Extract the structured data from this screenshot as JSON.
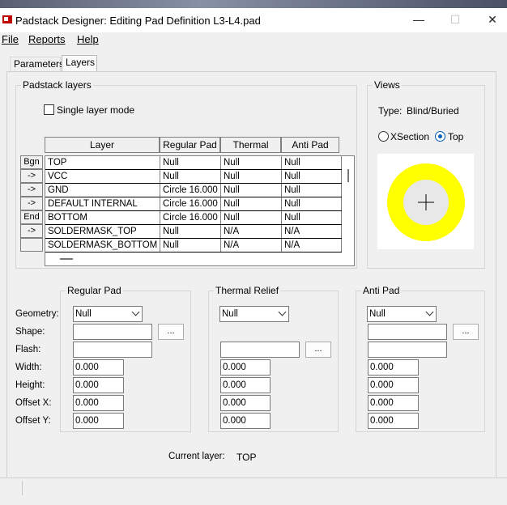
{
  "window": {
    "title": "Padstack Designer: Editing Pad Definition L3-L4.pad",
    "minimize": "—",
    "maximize": "☐",
    "close": "✕"
  },
  "menu": [
    "File",
    "Reports",
    "Help"
  ],
  "tabs": [
    {
      "label": "Parameters",
      "active": false
    },
    {
      "label": "Layers",
      "active": true
    }
  ],
  "padstack_layers": {
    "group_label": "Padstack layers",
    "single_layer_mode": {
      "label": "Single layer mode",
      "checked": false
    },
    "columns": [
      "Layer",
      "Regular Pad",
      "Thermal Relief",
      "Anti Pad"
    ],
    "rows": [
      {
        "button": "Bgn",
        "layer": "TOP",
        "regular": "Null",
        "thermal": "Null",
        "anti": "Null"
      },
      {
        "button": "->",
        "layer": "VCC",
        "regular": "Null",
        "thermal": "Null",
        "anti": "Null"
      },
      {
        "button": "->",
        "layer": "GND",
        "regular": "Circle 16.000",
        "thermal": "Null",
        "anti": "Null"
      },
      {
        "button": "->",
        "layer": "DEFAULT INTERNAL",
        "regular": "Circle 16.000",
        "thermal": "Null",
        "anti": "Null"
      },
      {
        "button": "End",
        "layer": "BOTTOM",
        "regular": "Circle 16.000",
        "thermal": "Null",
        "anti": "Null"
      },
      {
        "button": "->",
        "layer": "SOLDERMASK_TOP",
        "regular": "Null",
        "thermal": "N/A",
        "anti": "N/A"
      },
      {
        "button": "",
        "layer": "SOLDERMASK_BOTTOM",
        "regular": "Null",
        "thermal": "N/A",
        "anti": "N/A"
      }
    ]
  },
  "views": {
    "group_label": "Views",
    "type_label": "Type:",
    "type_value": "Blind/Buried",
    "options": [
      {
        "label": "XSection",
        "selected": false
      },
      {
        "label": "Top",
        "selected": true
      }
    ],
    "pad_color": "#ffff00",
    "hole_color": "#e8e8e8"
  },
  "fields": {
    "labels": [
      "Geometry:",
      "Shape:",
      "Flash:",
      "Width:",
      "Height:",
      "Offset X:",
      "Offset Y:"
    ],
    "regular": {
      "label": "Regular Pad",
      "geometry": "Null",
      "shape": "",
      "flash": "",
      "width": "0.000",
      "height": "0.000",
      "offset_x": "0.000",
      "offset_y": "0.000"
    },
    "thermal": {
      "label": "Thermal Relief",
      "geometry": "Null",
      "shape": "",
      "flash": "",
      "width": "0.000",
      "height": "0.000",
      "offset_x": "0.000",
      "offset_y": "0.000"
    },
    "anti": {
      "label": "Anti Pad",
      "geometry": "Null",
      "shape": "",
      "flash": "",
      "width": "0.000",
      "height": "0.000",
      "offset_x": "0.000",
      "offset_y": "0.000"
    },
    "browse_label": "..."
  },
  "current_layer": {
    "label": "Current layer:",
    "value": "TOP"
  }
}
